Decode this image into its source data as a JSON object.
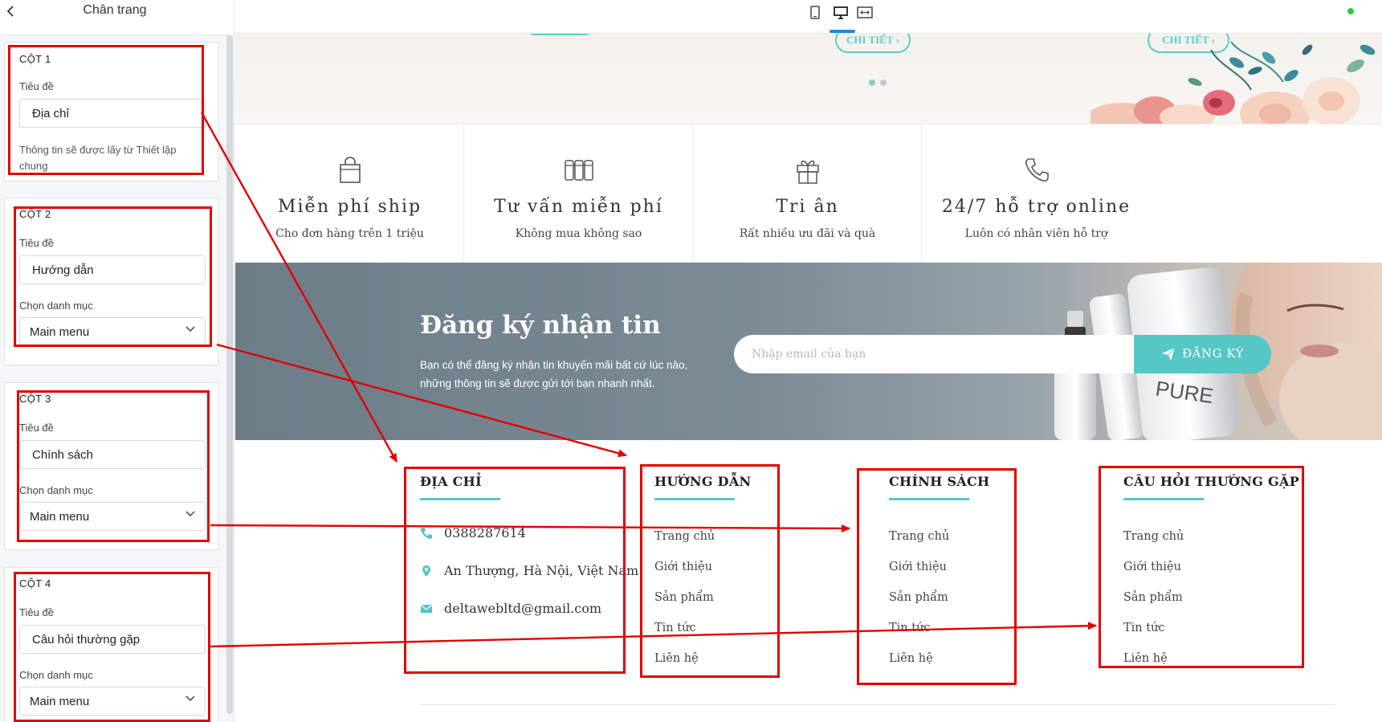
{
  "sidebar": {
    "title": "Chân trang",
    "back_icon": "chevron-left-icon",
    "columns": [
      {
        "heading": "CỘT 1",
        "title_label": "Tiêu đề",
        "title_value": "Địa chỉ",
        "note": "Thông tin sẽ được lấy từ Thiết lập chung"
      },
      {
        "heading": "CỘT 2",
        "title_label": "Tiêu đề",
        "title_value": "Hướng dẫn",
        "menu_label": "Chọn danh mục",
        "menu_value": "Main menu"
      },
      {
        "heading": "CỘT 3",
        "title_label": "Tiêu đề",
        "title_value": "Chính sách",
        "menu_label": "Chọn danh mục",
        "menu_value": "Main menu"
      },
      {
        "heading": "CỘT 4",
        "title_label": "Tiêu đề",
        "title_value": "Câu hỏi thường gặp",
        "menu_label": "Chọn danh mục",
        "menu_value": "Main menu"
      }
    ]
  },
  "toolbar": {
    "devices": [
      "mobile-icon",
      "desktop-icon",
      "fullwidth-icon"
    ],
    "active_device": "desktop-icon"
  },
  "hero": {
    "detail_buttons": [
      "CHI TIẾT ›",
      "CHI TIẾT ›"
    ],
    "slide_dots": 2,
    "active_dot": 0
  },
  "features": [
    {
      "icon": "shopping-bag-icon",
      "title": "Miễn phí ship",
      "subtitle": "Cho đơn hàng trên 1 triệu"
    },
    {
      "icon": "cosmetics-icon",
      "title": "Tư vấn miễn phí",
      "subtitle": "Không mua không sao"
    },
    {
      "icon": "gift-icon",
      "title": "Tri ân",
      "subtitle": "Rất nhiều ưu đãi và quà"
    },
    {
      "icon": "phone-icon",
      "title": "24/7 hỗ trợ online",
      "subtitle": "Luôn có nhân viên hỗ trợ"
    }
  ],
  "newsletter": {
    "title": "Đăng ký nhận tin",
    "description": "Bạn có thể đăng ký nhận tin khuyến mãi bất cứ lúc nào, những thông tin sẽ được gửi tới bạn nhanh nhất.",
    "placeholder": "Nhập email của bạn",
    "button_label": "ĐĂNG KÝ",
    "product_label": "PURE"
  },
  "footer": {
    "address": {
      "heading": "ĐỊA CHỈ",
      "phone": "0388287614",
      "location": "An Thượng, Hà Nội, Việt Nam",
      "email": "deltawebltd@gmail.com"
    },
    "columns": [
      {
        "heading": "HƯỚNG DẪN",
        "links": [
          "Trang chủ",
          "Giới thiệu",
          "Sản phẩm",
          "Tin tức",
          "Liên hệ"
        ]
      },
      {
        "heading": "CHÍNH SÁCH",
        "links": [
          "Trang chủ",
          "Giới thiệu",
          "Sản phẩm",
          "Tin tức",
          "Liên hệ"
        ]
      },
      {
        "heading": "CÂU HỎI THƯỜNG GẶP",
        "links": [
          "Trang chủ",
          "Giới thiệu",
          "Sản phẩm",
          "Tin tức",
          "Liên hệ"
        ]
      }
    ]
  },
  "colors": {
    "accent": "#55c7c4",
    "annotation": "#e30000",
    "newsletter_bg": "#7b8a95"
  }
}
